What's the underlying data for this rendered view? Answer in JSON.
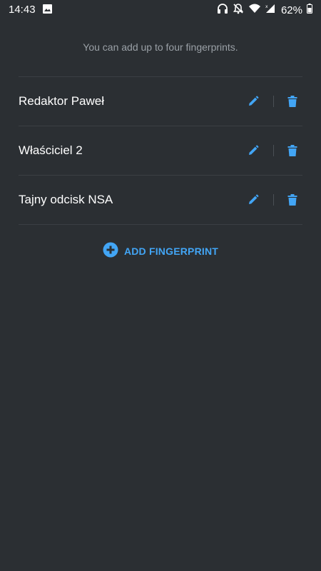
{
  "status_bar": {
    "time": "14:43",
    "battery": "62%",
    "icons": [
      "image-icon",
      "headset-icon",
      "notifications-off-icon",
      "wifi-icon",
      "signal-icon",
      "battery-icon"
    ]
  },
  "hint": "You can add up to four fingerprints.",
  "fingerprints": [
    {
      "label": "Redaktor Paweł"
    },
    {
      "label": "Właściciel 2"
    },
    {
      "label": "Tajny odcisk NSA"
    }
  ],
  "add_button": {
    "label": "ADD FINGERPRINT"
  },
  "colors": {
    "background": "#2b2f33",
    "accent": "#42a5f5",
    "divider": "#3b3f44",
    "hint_text": "#9aa0a6"
  }
}
